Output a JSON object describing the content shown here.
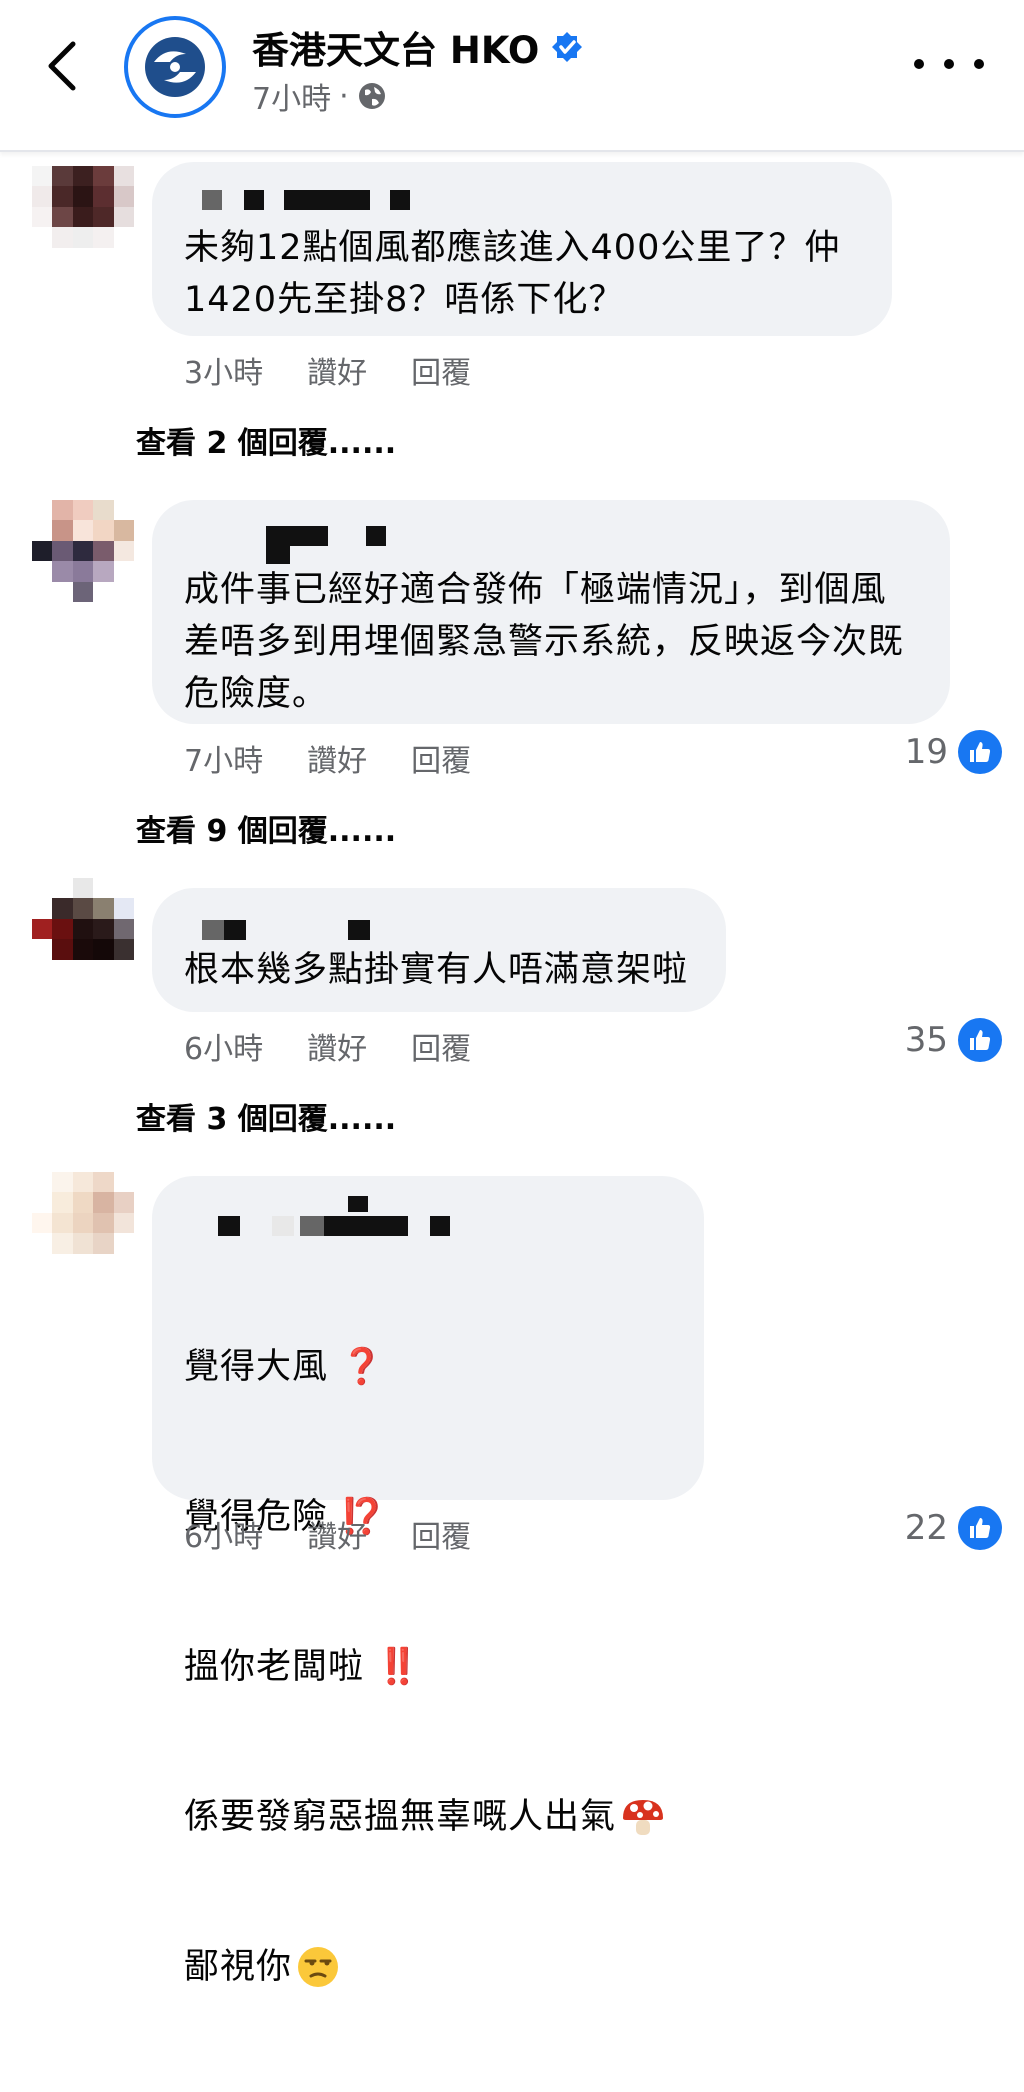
{
  "header": {
    "page_name": "香港天文台 HKO",
    "time": "7小時",
    "separator": "·"
  },
  "comments": [
    {
      "text": "未夠12點個風都應該進入400公里了？仲\n1420先至掛8？唔係下化？",
      "time": "3小時",
      "like_label": "讚好",
      "reply_label": "回覆",
      "view_replies": "查看 2 個回覆......"
    },
    {
      "text": "成件事已經好適合發佈「極端情況」，到個風\n差唔多到用埋個緊急警示系統，反映返今次既\n危險度。",
      "time": "7小時",
      "like_label": "讚好",
      "reply_label": "回覆",
      "reaction_count": "19",
      "view_replies": "查看 9 個回覆......"
    },
    {
      "text": "根本幾多點掛實有人唔滿意架啦",
      "time": "6小時",
      "like_label": "讚好",
      "reply_label": "回覆",
      "reaction_count": "35",
      "view_replies": "查看 3 個回覆......"
    },
    {
      "lines": [
        "覺得大風",
        "覺得危險",
        "搵你老闆啦",
        "係要發窮惡搵無辜嘅人出氣",
        "鄙視你"
      ],
      "line_emojis": [
        "❓",
        "⁉️",
        "‼️",
        "mushroom",
        "unamused-face"
      ],
      "time": "6小時",
      "like_label": "讚好",
      "reply_label": "回覆",
      "reaction_count": "22"
    }
  ],
  "colors": {
    "accent": "#1877f2",
    "bubble": "#f0f2f5",
    "secondary_text": "#65676b"
  }
}
